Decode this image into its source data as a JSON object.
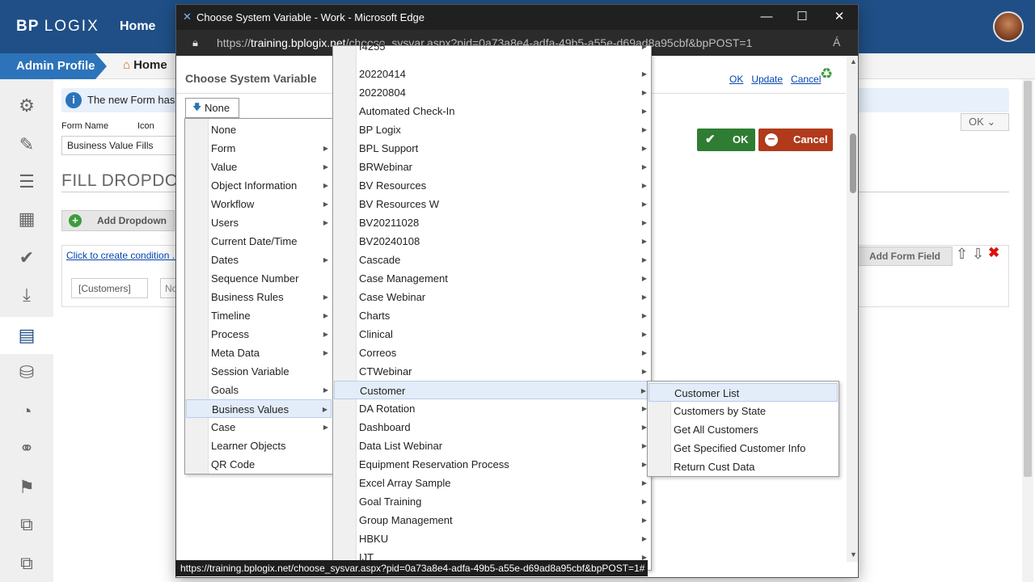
{
  "app": {
    "logo_bp": "BP",
    "logo_logix": "LOGIX",
    "home_nav": "Home",
    "admin_profile": "Admin Profile",
    "breadcrumb_home": "Home",
    "info_message": "The new Form has b",
    "form_name_label": "Form Name",
    "icon_label": "Icon",
    "form_name_value": "Business Value Fills",
    "page_heading": "FILL DROPDOW",
    "add_dropdown": "Add Dropdown",
    "create_condition": "Click to create condition ..",
    "customers_value": "[Customers]",
    "second_input_value": "No",
    "ok_select": "OK",
    "add_form_field": "Add Form Field"
  },
  "popup": {
    "window_title": "Choose System Variable - Work - Microsoft Edge",
    "url_prefix": "https://",
    "url_host": "training.bplogix.net",
    "url_path": "/choose_sysvar.aspx?pid=0a73a8e4-adfa-49b5-a55e-d69ad8a95cbf&bpPOST=1",
    "dialog_title": "Choose System Variable",
    "link_ok": "OK",
    "link_update": "Update",
    "link_cancel": "Cancel",
    "ok_button": "OK",
    "cancel_button": "Cancel",
    "none_dropdown": "None",
    "status_url": "https://training.bplogix.net/choose_sysvar.aspx?pid=0a73a8e4-adfa-49b5-a55e-d69ad8a95cbf&bpPOST=1#"
  },
  "menu1": [
    {
      "label": "None",
      "sub": false
    },
    {
      "label": "Form",
      "sub": true
    },
    {
      "label": "Value",
      "sub": true
    },
    {
      "label": "Object Information",
      "sub": true
    },
    {
      "label": "Workflow",
      "sub": true
    },
    {
      "label": "Users",
      "sub": true
    },
    {
      "label": "Current Date/Time",
      "sub": false
    },
    {
      "label": "Dates",
      "sub": true
    },
    {
      "label": "Sequence Number",
      "sub": false
    },
    {
      "label": "Business Rules",
      "sub": true
    },
    {
      "label": "Timeline",
      "sub": true
    },
    {
      "label": "Process",
      "sub": true
    },
    {
      "label": "Meta Data",
      "sub": true
    },
    {
      "label": "Session Variable",
      "sub": false
    },
    {
      "label": "Goals",
      "sub": true
    },
    {
      "label": "Business Values",
      "sub": true,
      "selected": true
    },
    {
      "label": "Case",
      "sub": true
    },
    {
      "label": "Learner Objects",
      "sub": false
    },
    {
      "label": "QR Code",
      "sub": false
    }
  ],
  "menu2_partial_top": "I4255",
  "menu2": [
    {
      "label": "20220414"
    },
    {
      "label": "20220804"
    },
    {
      "label": "Automated Check-In"
    },
    {
      "label": "BP Logix"
    },
    {
      "label": "BPL Support"
    },
    {
      "label": "BRWebinar"
    },
    {
      "label": "BV Resources"
    },
    {
      "label": "BV Resources W"
    },
    {
      "label": "BV20211028"
    },
    {
      "label": "BV20240108"
    },
    {
      "label": "Cascade"
    },
    {
      "label": "Case Management"
    },
    {
      "label": "Case Webinar"
    },
    {
      "label": "Charts"
    },
    {
      "label": "Clinical"
    },
    {
      "label": "Correos"
    },
    {
      "label": "CTWebinar"
    },
    {
      "label": "Customer",
      "selected": true
    },
    {
      "label": "DA Rotation"
    },
    {
      "label": "Dashboard"
    },
    {
      "label": "Data List Webinar"
    },
    {
      "label": "Equipment Reservation Process"
    },
    {
      "label": "Excel Array Sample"
    },
    {
      "label": "Goal Training"
    },
    {
      "label": "Group Management"
    },
    {
      "label": "HBKU"
    },
    {
      "label": "IJT"
    }
  ],
  "menu3": [
    {
      "label": "Customer List",
      "selected": true
    },
    {
      "label": "Customers by State"
    },
    {
      "label": "Get All Customers"
    },
    {
      "label": "Get Specified Customer Info"
    },
    {
      "label": "Return Cust Data"
    }
  ],
  "sidebar_icons": [
    "gears-icon",
    "edit-icon",
    "list-icon",
    "table-icon",
    "check-icon",
    "download-icon",
    "form-icon",
    "database-add-icon",
    "speed-icon",
    "link-icon",
    "flag-icon",
    "copy-icon",
    "clone-icon"
  ],
  "colors": {
    "brand": "#1f4f86",
    "accent": "#2d73b9",
    "ok_green": "#2e7d32",
    "cancel_red": "#b03a1a"
  }
}
